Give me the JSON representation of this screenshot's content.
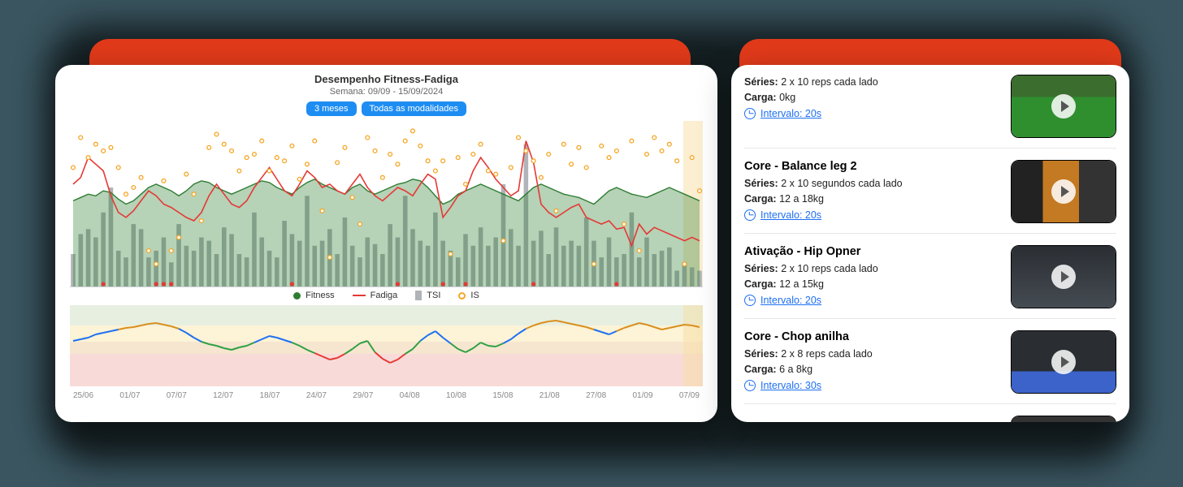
{
  "chart_data": {
    "main": {
      "type": "line+bar+scatter+area",
      "title": "Desempenho Fitness-Fadiga",
      "subtitle": "Semana: 09/09 - 15/09/2024",
      "filters": {
        "range": "3 meses",
        "modalities": "Todas as modalidades"
      },
      "x_ticks": [
        "25/06",
        "01/07",
        "07/07",
        "12/07",
        "18/07",
        "24/07",
        "29/07",
        "04/08",
        "10/08",
        "15/08",
        "21/08",
        "27/08",
        "01/09",
        "07/09"
      ],
      "legend": [
        {
          "name": "Fitness",
          "kind": "area",
          "color": "#2e7d32"
        },
        {
          "name": "Fadiga",
          "kind": "line",
          "color": "#e53935"
        },
        {
          "name": "TSI",
          "kind": "bar",
          "color": "#b0b3b8"
        },
        {
          "name": "IS",
          "kind": "scatter",
          "color": "#f5a623"
        }
      ],
      "ylim": [
        0,
        100
      ],
      "fitness_area": [
        52,
        54,
        56,
        55,
        58,
        57,
        53,
        50,
        52,
        56,
        60,
        62,
        60,
        58,
        55,
        58,
        62,
        64,
        63,
        60,
        58,
        56,
        58,
        60,
        62,
        64,
        63,
        60,
        58,
        56,
        60,
        63,
        65,
        62,
        60,
        58,
        56,
        60,
        62,
        58,
        56,
        58,
        60,
        62,
        63,
        65,
        64,
        60,
        55,
        50,
        52,
        56,
        58,
        60,
        62,
        60,
        58,
        56,
        54,
        52,
        56,
        60,
        62,
        60,
        58,
        56,
        55,
        54,
        52,
        50,
        54,
        58,
        60,
        58,
        56,
        55,
        54,
        56,
        58,
        60,
        58,
        56,
        54,
        52
      ],
      "fadiga_line": [
        62,
        66,
        78,
        74,
        70,
        55,
        45,
        42,
        46,
        52,
        58,
        55,
        50,
        48,
        45,
        42,
        40,
        45,
        55,
        62,
        56,
        50,
        48,
        52,
        60,
        66,
        72,
        65,
        58,
        55,
        62,
        70,
        66,
        60,
        62,
        58,
        56,
        62,
        68,
        60,
        55,
        52,
        56,
        60,
        58,
        55,
        62,
        68,
        65,
        42,
        48,
        55,
        58,
        70,
        78,
        72,
        65,
        60,
        55,
        58,
        88,
        75,
        50,
        45,
        42,
        45,
        48,
        50,
        42,
        40,
        38,
        40,
        35,
        36,
        25,
        38,
        32,
        36,
        34,
        32,
        30,
        28,
        30,
        28
      ],
      "tsi_bars": [
        20,
        32,
        35,
        30,
        45,
        60,
        22,
        18,
        38,
        35,
        18,
        22,
        30,
        15,
        38,
        25,
        22,
        30,
        28,
        20,
        36,
        32,
        20,
        18,
        45,
        30,
        22,
        18,
        40,
        32,
        28,
        55,
        25,
        28,
        35,
        20,
        42,
        25,
        18,
        30,
        26,
        20,
        38,
        30,
        55,
        35,
        28,
        25,
        45,
        28,
        22,
        18,
        32,
        25,
        36,
        25,
        30,
        62,
        35,
        25,
        86,
        28,
        34,
        20,
        36,
        25,
        28,
        25,
        42,
        28,
        18,
        30,
        18,
        20,
        45,
        18,
        30,
        20,
        22,
        24,
        10,
        15,
        12,
        10
      ],
      "is_scatter": [
        72,
        90,
        78,
        86,
        82,
        84,
        72,
        56,
        60,
        66,
        22,
        14,
        64,
        22,
        30,
        68,
        56,
        40,
        84,
        92,
        86,
        82,
        70,
        78,
        80,
        88,
        70,
        78,
        76,
        85,
        65,
        74,
        88,
        46,
        18,
        75,
        84,
        54,
        38,
        90,
        82,
        66,
        80,
        74,
        88,
        94,
        85,
        76,
        70,
        76,
        20,
        78,
        62,
        80,
        86,
        70,
        68,
        28,
        72,
        90,
        82,
        76,
        66,
        80,
        46,
        86,
        74,
        84,
        72,
        14,
        85,
        78,
        82,
        38,
        88,
        22,
        80,
        90,
        82,
        86,
        76,
        14,
        78,
        58
      ],
      "sane_dots_x_idx": [
        4,
        11,
        12,
        13,
        29,
        43,
        49,
        52,
        61,
        72
      ]
    },
    "secondary": {
      "type": "line-colored",
      "ylim": [
        0,
        10
      ],
      "bands": [
        {
          "from": 7.5,
          "to": 10,
          "color": "#e7efe0"
        },
        {
          "from": 5.5,
          "to": 7.5,
          "color": "#fdf3d6"
        },
        {
          "from": 4,
          "to": 5.5,
          "color": "#f6e6d0"
        },
        {
          "from": 0,
          "to": 4,
          "color": "#f8dbd8"
        }
      ],
      "values": [
        5.6,
        5.8,
        6.0,
        6.4,
        6.6,
        6.8,
        7.0,
        7.2,
        7.3,
        7.5,
        7.7,
        7.8,
        7.6,
        7.4,
        7.1,
        6.6,
        6.0,
        5.5,
        5.2,
        5.0,
        4.7,
        4.5,
        4.8,
        5.0,
        5.4,
        5.8,
        6.2,
        6.0,
        5.7,
        5.4,
        5.0,
        4.5,
        4.1,
        3.7,
        3.3,
        3.5,
        4.0,
        4.6,
        5.3,
        5.6,
        4.2,
        3.4,
        2.9,
        3.3,
        4.0,
        4.6,
        5.6,
        6.3,
        6.8,
        6.0,
        5.3,
        4.6,
        4.2,
        4.7,
        5.4,
        5.0,
        4.9,
        5.3,
        5.8,
        6.5,
        7.1,
        7.5,
        7.8,
        8.0,
        8.1,
        7.9,
        7.7,
        7.5,
        7.3,
        7.0,
        6.7,
        6.4,
        6.8,
        7.2,
        7.5,
        7.8,
        7.6,
        7.3,
        7.0,
        7.2,
        7.4,
        7.6,
        7.5,
        7.3
      ],
      "seg_colors": {
        "green": "#2ea043",
        "orange": "#d98f1d",
        "red": "#e53935",
        "blue": "#1d6ff2"
      }
    }
  },
  "exercises": [
    {
      "title": "",
      "series_label": "Séries:",
      "series_value": "2 x 10 reps cada lado",
      "carga_label": "Carga:",
      "carga_value": "0kg",
      "interval_label": "Intervalo: 20s",
      "thumb_hint": "green-field"
    },
    {
      "title": "Core - Balance leg 2",
      "series_label": "Séries:",
      "series_value": "2 x 10 segundos cada lado",
      "carga_label": "Carga:",
      "carga_value": "12 a 18kg",
      "interval_label": "Intervalo: 20s",
      "thumb_hint": "gym-orange"
    },
    {
      "title": "Ativação - Hip Opner",
      "series_label": "Séries:",
      "series_value": "2 x 10 reps cada lado",
      "carga_label": "Carga:",
      "carga_value": "12 a 15kg",
      "interval_label": "Intervalo: 20s",
      "thumb_hint": "gym-dark"
    },
    {
      "title": "Core - Chop anilha",
      "series_label": "Séries:",
      "series_value": "2 x 8 reps cada lado",
      "carga_label": "Carga:",
      "carga_value": "6 a 8kg",
      "interval_label": "Intervalo: 30s",
      "thumb_hint": "gym-bluemat"
    }
  ]
}
